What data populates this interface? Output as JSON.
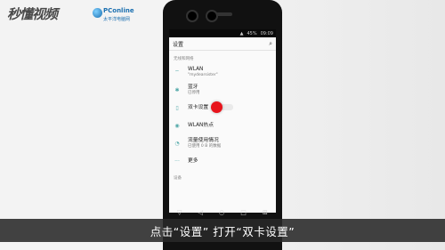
{
  "watermark": {
    "left_logo": "秒懂视频",
    "right_logo_title": "PConline",
    "right_logo_sub": "太平洋电脑网"
  },
  "statusbar": {
    "signal": "▲",
    "battery": "45%",
    "time": "09:09"
  },
  "settings": {
    "title": "设置",
    "search_icon": "search-icon",
    "section_header": "无线和网络",
    "items": [
      {
        "icon": "⌔",
        "label": "WLAN",
        "sub": "\"mydearsister\""
      },
      {
        "icon": "✱",
        "label": "蓝牙",
        "sub": "已停用"
      },
      {
        "icon": "▯",
        "label": "双卡设置",
        "sub": ""
      },
      {
        "icon": "◉",
        "label": "WLAN热点",
        "sub": ""
      },
      {
        "icon": "◔",
        "label": "流量使用情况",
        "sub": "已使用 0 B 的数据"
      },
      {
        "icon": "···",
        "label": "更多",
        "sub": ""
      }
    ],
    "next_section": "设备"
  },
  "navbar": {
    "left": "▽",
    "back": "◁",
    "home": "○",
    "recent": "□",
    "right": "⊞"
  },
  "caption": "点击“设置” 打开“双卡设置”",
  "colors": {
    "accent_red": "#e8141c",
    "caption_bg": "#282828"
  }
}
